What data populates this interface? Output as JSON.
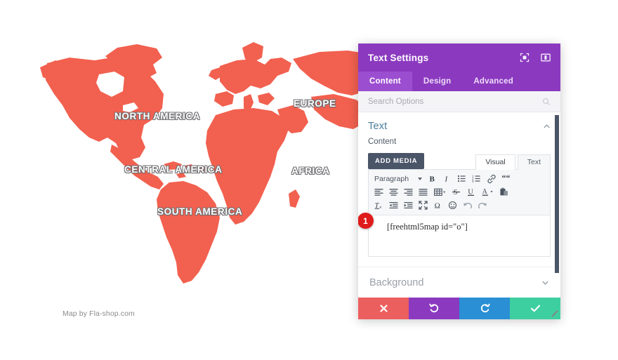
{
  "map": {
    "labels": [
      {
        "id": "north-america",
        "text": "NORTH AMERICA"
      },
      {
        "id": "central-america",
        "text": "CENTRAL AMERICA"
      },
      {
        "id": "south-america",
        "text": "SOUTH AMERICA"
      },
      {
        "id": "europe",
        "text": "EUROPE"
      },
      {
        "id": "africa",
        "text": "AFRICA"
      }
    ],
    "credit": "Map by Fla-shop.com",
    "land_color": "#f2604f",
    "ocean_color": "#ffffff",
    "label_color": "#ffffff"
  },
  "panel": {
    "title": "Text Settings",
    "header_icons": [
      {
        "name": "fullscreen-target-icon",
        "label": "Fullscreen"
      },
      {
        "name": "split-panel-icon",
        "label": "Panel layout"
      }
    ],
    "accent_color": "#8b3ac0",
    "tabs": [
      {
        "label": "Content",
        "active": true
      },
      {
        "label": "Design",
        "active": false
      },
      {
        "label": "Advanced",
        "active": false
      }
    ],
    "search": {
      "placeholder": "Search Options",
      "value": ""
    },
    "section": {
      "title": "Text",
      "collapsed": false,
      "field_label": "Content"
    },
    "add_media_label": "ADD MEDIA",
    "editor_modes": [
      {
        "label": "Visual",
        "active": true
      },
      {
        "label": "Text",
        "active": false
      }
    ],
    "toolbar": {
      "format_select": "Paragraph",
      "row1": [
        {
          "name": "bold-icon",
          "title": "Bold"
        },
        {
          "name": "italic-icon",
          "title": "Italic"
        },
        {
          "name": "bulleted-list-icon",
          "title": "Bulleted list"
        },
        {
          "name": "numbered-list-icon",
          "title": "Numbered list"
        },
        {
          "name": "link-icon",
          "title": "Insert link"
        },
        {
          "name": "blockquote-icon",
          "title": "Blockquote"
        }
      ],
      "row2": [
        {
          "name": "align-left-icon",
          "title": "Align left"
        },
        {
          "name": "align-center-icon",
          "title": "Align center"
        },
        {
          "name": "align-right-icon",
          "title": "Align right"
        },
        {
          "name": "align-justify-icon",
          "title": "Justify"
        },
        {
          "name": "table-icon",
          "title": "Table"
        },
        {
          "name": "strikethrough-icon",
          "title": "Strikethrough"
        },
        {
          "name": "underline-icon",
          "title": "Underline"
        },
        {
          "name": "text-color-icon",
          "title": "Text color"
        },
        {
          "name": "paste-as-text-icon",
          "title": "Paste as text"
        }
      ],
      "row3": [
        {
          "name": "clear-formatting-icon",
          "title": "Clear formatting"
        },
        {
          "name": "outdent-icon",
          "title": "Decrease indent"
        },
        {
          "name": "indent-icon",
          "title": "Increase indent"
        },
        {
          "name": "distraction-free-icon",
          "title": "Distraction free"
        },
        {
          "name": "special-character-icon",
          "title": "Special character"
        },
        {
          "name": "emoji-icon",
          "title": "Insert emoji"
        },
        {
          "name": "undo-icon",
          "title": "Undo"
        },
        {
          "name": "redo-icon",
          "title": "Redo"
        }
      ]
    },
    "editor_value": "[freehtml5map id=\"o\"]",
    "step_badge": "1",
    "background_section": {
      "title": "Background",
      "collapsed": true
    },
    "actions": [
      {
        "name": "cancel-button",
        "icon": "close-icon",
        "color": "#ec5f5f"
      },
      {
        "name": "undo-button",
        "icon": "undo-icon",
        "color": "#8b3ac0"
      },
      {
        "name": "redo-button",
        "icon": "redo-icon",
        "color": "#2a8fd4"
      },
      {
        "name": "save-button",
        "icon": "check-icon",
        "color": "#3ecfa0"
      }
    ]
  }
}
